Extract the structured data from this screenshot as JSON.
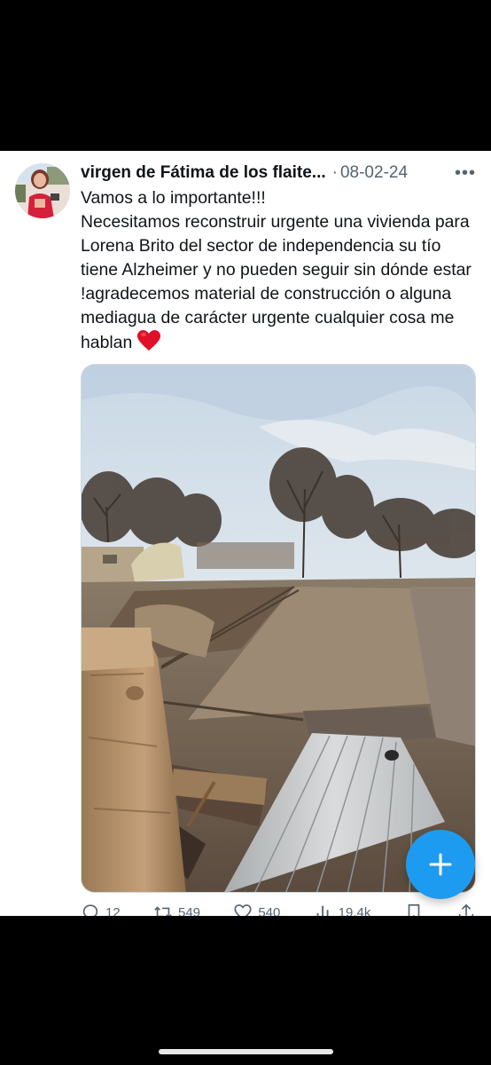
{
  "tweet": {
    "author": {
      "display_name": "virgen de Fátima de los flaite...",
      "avatar_icon": "profile-photo"
    },
    "separator": "·",
    "date": "08-02-24",
    "more_icon": "more-horizontal-icon",
    "text": "Vamos a lo importante!!!\nNecesitamos reconstruir urgente una vivienda para Lorena Brito del sector de independencia su tío tiene Alzheimer y no pueden seguir sin dónde estar !agradecemos material de construcción o alguna mediagua de carácter urgente cualquier cosa me hablan",
    "emoji": "red-heart",
    "media_description_icon": "photo"
  },
  "actions": {
    "reply": {
      "icon": "reply-icon",
      "count": "12"
    },
    "retweet": {
      "icon": "retweet-icon",
      "count": "549"
    },
    "like": {
      "icon": "like-icon",
      "count": "540"
    },
    "views": {
      "icon": "views-icon",
      "count": "19,4k"
    },
    "bookmark": {
      "icon": "bookmark-icon"
    },
    "share": {
      "icon": "share-icon"
    }
  },
  "fab": {
    "icon": "plus-icon",
    "color": "#1d9bf0"
  },
  "colors": {
    "text": "#0f1419",
    "secondary": "#536471",
    "accent": "#1d9bf0"
  }
}
